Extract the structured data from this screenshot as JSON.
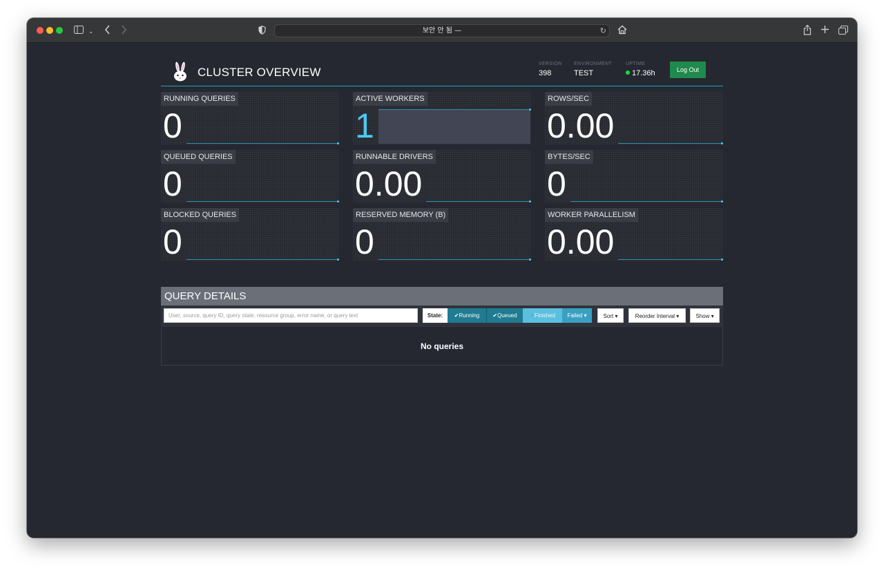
{
  "browser": {
    "url_text": "보안 안 됨 —",
    "icons": [
      "sidebar-icon",
      "chevron-down-icon",
      "back-icon",
      "forward-icon",
      "shield-icon",
      "reload-icon",
      "home-icon",
      "share-icon",
      "plus-icon",
      "tabs-icon"
    ]
  },
  "header": {
    "title": "CLUSTER OVERVIEW",
    "version_label": "VERSION",
    "version_value": "398",
    "environment_label": "ENVIRONMENT",
    "environment_value": "TEST",
    "uptime_label": "UPTIME",
    "uptime_value": "17.36h",
    "logout_label": "Log Out"
  },
  "tiles": [
    {
      "label": "RUNNING QUERIES",
      "value": "0"
    },
    {
      "label": "ACTIVE WORKERS",
      "value": "1"
    },
    {
      "label": "ROWS/SEC",
      "value": "0.00"
    },
    {
      "label": "QUEUED QUERIES",
      "value": "0"
    },
    {
      "label": "RUNNABLE DRIVERS",
      "value": "0.00"
    },
    {
      "label": "BYTES/SEC",
      "value": "0"
    },
    {
      "label": "BLOCKED QUERIES",
      "value": "0"
    },
    {
      "label": "RESERVED MEMORY (B)",
      "value": "0"
    },
    {
      "label": "WORKER PARALLELISM",
      "value": "0.00"
    }
  ],
  "query_details": {
    "title": "QUERY DETAILS",
    "search_placeholder": "User, source, query ID, query state, resource group, error name, or query text",
    "state_label": "State:",
    "running_label": "Running",
    "queued_label": "Queued",
    "finished_label": "Finished",
    "failed_label": "Failed",
    "sort_label": "Sort",
    "reorder_label": "Reorder Interval",
    "show_label": "Show",
    "empty_text": "No queries"
  },
  "colors": {
    "accent": "#4bc9f5",
    "logout": "#1f8a4d",
    "uptime_dot": "#1edc3c"
  }
}
